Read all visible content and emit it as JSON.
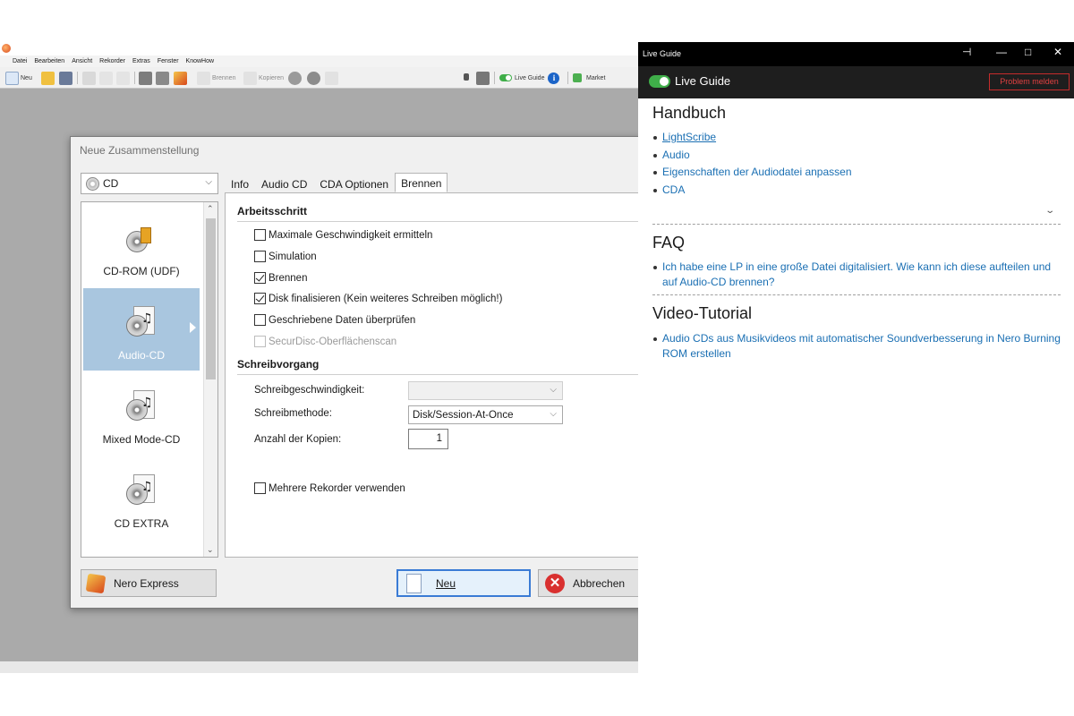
{
  "app": {
    "menu": [
      "Datei",
      "Bearbeiten",
      "Ansicht",
      "Rekorder",
      "Extras",
      "Fenster",
      "KnowHow"
    ],
    "toolbar": {
      "new_label": "Neu",
      "burn_label": "Brennen",
      "copy_label": "Kopieren",
      "live_guide_label": "Live Guide",
      "market_label": "Market"
    }
  },
  "dialog": {
    "title": "Neue Zusammenstellung",
    "media_type": "CD",
    "compilations": [
      {
        "label": "CD-ROM (UDF)",
        "icon": "cd-rom-icon"
      },
      {
        "label": "Audio-CD",
        "icon": "audio-cd-icon",
        "selected": true
      },
      {
        "label": "Mixed Mode-CD",
        "icon": "mixed-mode-icon"
      },
      {
        "label": "CD EXTRA",
        "icon": "cd-extra-icon"
      }
    ],
    "tabs": [
      "Info",
      "Audio CD",
      "CDA Optionen",
      "Brennen"
    ],
    "active_tab": "Brennen",
    "section_step": "Arbeitsschritt",
    "options": [
      {
        "label": "Maximale Geschwindigkeit ermitteln",
        "checked": false
      },
      {
        "label": "Simulation",
        "checked": false
      },
      {
        "label": "Brennen",
        "checked": true
      },
      {
        "label": "Disk finalisieren (Kein weiteres Schreiben möglich!)",
        "checked": true
      },
      {
        "label": "Geschriebene Daten überprüfen",
        "checked": false
      },
      {
        "label": "SecurDisc-Oberflächenscan",
        "checked": false,
        "disabled": true
      }
    ],
    "section_write": "Schreibvorgang",
    "write_speed_label": "Schreibgeschwindigkeit:",
    "write_speed_value": "",
    "write_method_label": "Schreibmethode:",
    "write_method_value": "Disk/Session-At-Once",
    "copies_label": "Anzahl der Kopien:",
    "copies_value": "1",
    "multi_recorder_label": "Mehrere Rekorder verwenden",
    "nero_express_label": "Nero Express",
    "new_button_label": "Neu",
    "cancel_button_label": "Abbrechen"
  },
  "live_guide": {
    "window_title": "Live Guide",
    "header_label": "Live Guide",
    "problem_button": "Problem melden",
    "handbuch_heading": "Handbuch",
    "handbuch_links": [
      "LightScribe",
      "Audio",
      "Eigenschaften der Audiodatei anpassen",
      "CDA"
    ],
    "faq_heading": "FAQ",
    "faq_links": [
      "Ich habe eine LP in eine große Datei digitalisiert. Wie kann ich diese aufteilen und auf Audio-CD brennen?"
    ],
    "video_heading": "Video-Tutorial",
    "video_links": [
      "Audio CDs aus Musikvideos mit automatischer Soundverbesserung in Nero Burning ROM erstellen"
    ]
  },
  "colors": {
    "accent_blue": "#1a6fb3",
    "toggle_green": "#3fae49",
    "selection": "#a9c6df",
    "problem_red": "#e04040"
  }
}
